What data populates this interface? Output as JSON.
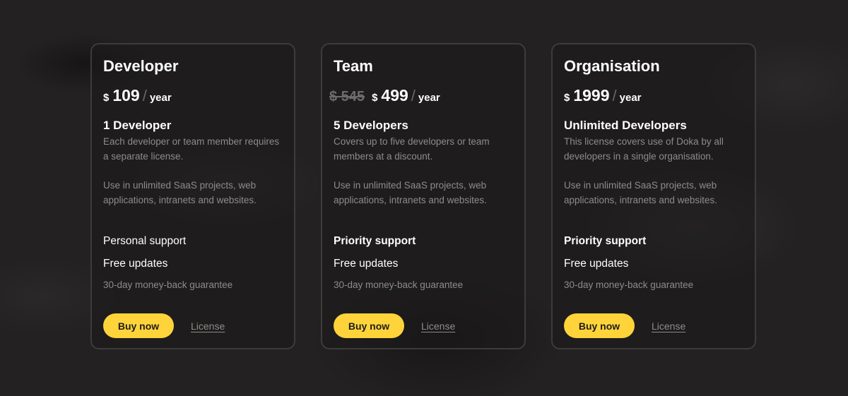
{
  "cards": [
    {
      "title": "Developer",
      "old_price": "",
      "currency": "$",
      "price": "109",
      "separator": "/",
      "period": "year",
      "developers": "1 Developer",
      "description": "Each developer or team member requires a separate license.",
      "usage": "Use in unlimited SaaS projects, web applications, intranets and websites.",
      "support": "Personal support",
      "updates": "Free updates",
      "guarantee": "30-day money-back guarantee",
      "buy_label": "Buy now",
      "license_label": "License"
    },
    {
      "title": "Team",
      "old_price": "$ 545",
      "currency": "$",
      "price": "499",
      "separator": "/",
      "period": "year",
      "developers": "5 Developers",
      "description": "Covers up to five developers or team members at a discount.",
      "usage": "Use in unlimited SaaS projects, web applications, intranets and websites.",
      "support": "Priority support",
      "updates": "Free updates",
      "guarantee": "30-day money-back guarantee",
      "buy_label": "Buy now",
      "license_label": "License"
    },
    {
      "title": "Organisation",
      "old_price": "",
      "currency": "$",
      "price": "1999",
      "separator": "/",
      "period": "year",
      "developers": "Unlimited Developers",
      "description": "This license covers use of Doka by all developers in a single organisation.",
      "usage": "Use in unlimited SaaS projects, web applications, intranets and websites.",
      "support": "Priority support",
      "updates": "Free updates",
      "guarantee": "30-day money-back guarantee",
      "buy_label": "Buy now",
      "license_label": "License"
    }
  ],
  "colors": {
    "accent": "#ffd43a",
    "background": "#232121",
    "muted_text": "#8f8b8b"
  }
}
